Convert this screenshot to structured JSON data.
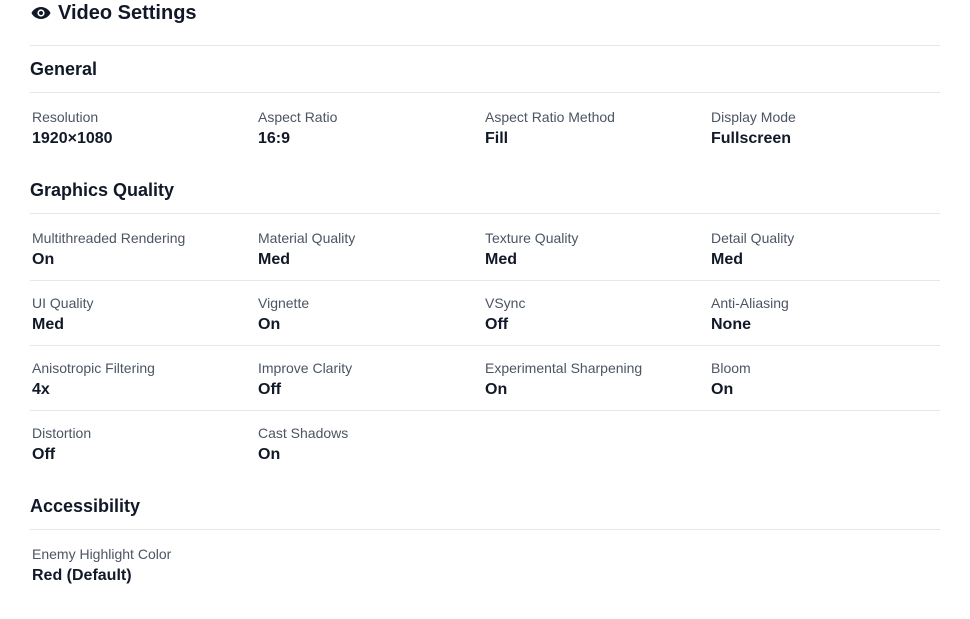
{
  "header": {
    "title": "Video Settings",
    "icon": "eye-icon"
  },
  "sections": {
    "general": {
      "title": "General",
      "rows": [
        [
          {
            "label": "Resolution",
            "value": "1920×1080"
          },
          {
            "label": "Aspect Ratio",
            "value": "16:9"
          },
          {
            "label": "Aspect Ratio Method",
            "value": "Fill"
          },
          {
            "label": "Display Mode",
            "value": "Fullscreen"
          }
        ]
      ]
    },
    "graphics": {
      "title": "Graphics Quality",
      "rows": [
        [
          {
            "label": "Multithreaded Rendering",
            "value": "On"
          },
          {
            "label": "Material Quality",
            "value": "Med"
          },
          {
            "label": "Texture Quality",
            "value": "Med"
          },
          {
            "label": "Detail Quality",
            "value": "Med"
          }
        ],
        [
          {
            "label": "UI Quality",
            "value": "Med"
          },
          {
            "label": "Vignette",
            "value": "On"
          },
          {
            "label": "VSync",
            "value": "Off"
          },
          {
            "label": "Anti-Aliasing",
            "value": "None"
          }
        ],
        [
          {
            "label": "Anisotropic Filtering",
            "value": "4x"
          },
          {
            "label": "Improve Clarity",
            "value": "Off"
          },
          {
            "label": "Experimental Sharpening",
            "value": "On"
          },
          {
            "label": "Bloom",
            "value": "On"
          }
        ],
        [
          {
            "label": "Distortion",
            "value": "Off"
          },
          {
            "label": "Cast Shadows",
            "value": "On"
          }
        ]
      ]
    },
    "accessibility": {
      "title": "Accessibility",
      "rows": [
        [
          {
            "label": "Enemy Highlight Color",
            "value": "Red (Default)"
          }
        ]
      ]
    }
  },
  "colors": {
    "divider": "#e5e7eb",
    "label": "#4b5563",
    "value": "#111827"
  }
}
